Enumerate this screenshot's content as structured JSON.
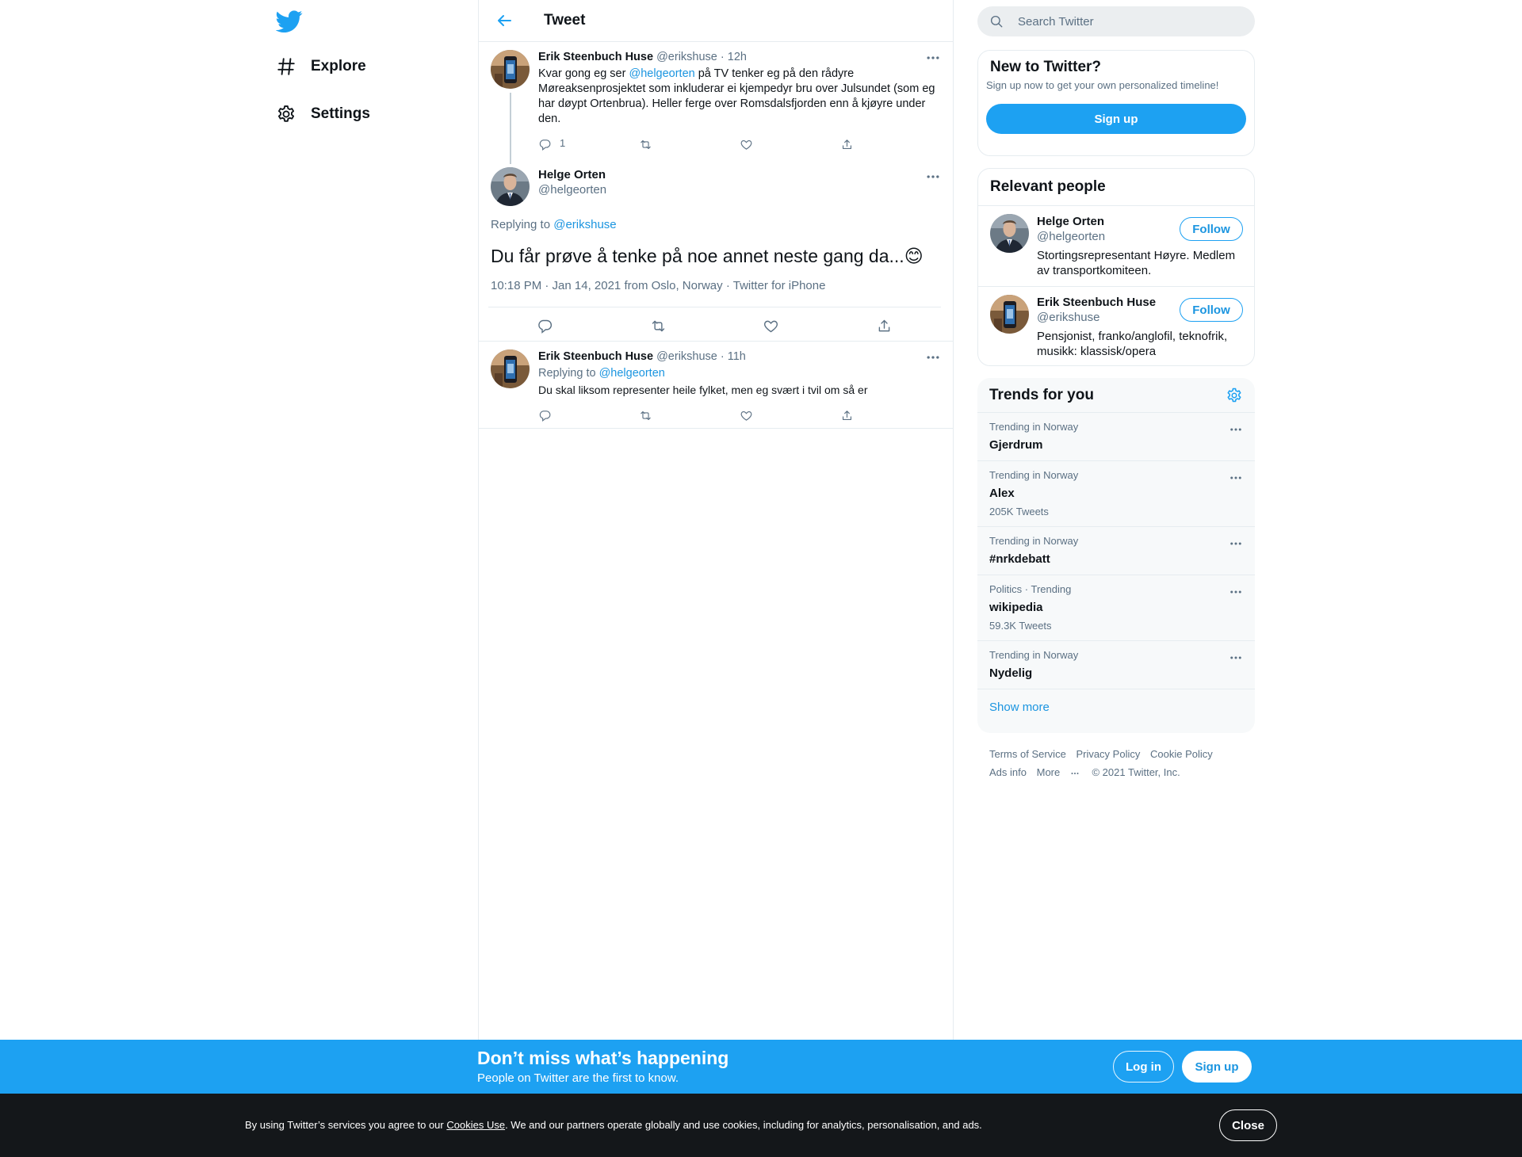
{
  "nav": {
    "explore_label": "Explore",
    "settings_label": "Settings"
  },
  "header": {
    "title": "Tweet"
  },
  "parent_tweet": {
    "name": "Erik Steenbuch Huse",
    "handle": "@erikshuse",
    "time": "12h",
    "text_before": "Kvar gong eg ser ",
    "mention": "@helgeorten",
    "text_after": " på TV tenker eg på den rådyre Møreaksenprosjektet som inkluderar ei kjempedyr bru over Julsundet (som eg har døypt Ortenbrua).  Heller ferge over Romsdalsfjorden enn å kjøyre under den.",
    "reply_count": "1"
  },
  "main_tweet": {
    "name": "Helge Orten",
    "handle": "@helgeorten",
    "replying_to_label": "Replying to ",
    "replying_to_handle": "@erikshuse",
    "text": "Du får prøve å tenke på noe annet neste gang da...",
    "emoji": "😊",
    "time": "10:18 PM · Jan 14, 2021",
    "location": "from Oslo, Norway",
    "source": "Twitter for iPhone"
  },
  "reply_tweet": {
    "name": "Erik Steenbuch Huse",
    "handle": "@erikshuse",
    "time": "11h",
    "replying_to_label": "Replying to ",
    "replying_to_handle": "@helgeorten",
    "text": "Du skal liksom representer heile fylket, men eg svært i tvil om så er"
  },
  "search": {
    "placeholder": "Search Twitter"
  },
  "signup_card": {
    "title": "New to Twitter?",
    "subtitle": "Sign up now to get your own personalized timeline!",
    "button": "Sign up"
  },
  "relevant_people": {
    "title": "Relevant people",
    "people": [
      {
        "name": "Helge Orten",
        "handle": "@helgeorten",
        "bio": "Stortingsrepresentant Høyre. Medlem av transportkomiteen.",
        "follow": "Follow"
      },
      {
        "name": "Erik Steenbuch Huse",
        "handle": "@erikshuse",
        "bio": "Pensjonist, franko/anglofil, teknofrik, musikk: klassisk/opera",
        "follow": "Follow"
      }
    ]
  },
  "trends": {
    "title": "Trends for you",
    "items": [
      {
        "context": "Trending in Norway",
        "name": "Gjerdrum",
        "count": ""
      },
      {
        "context": "Trending in Norway",
        "name": "Alex",
        "count": "205K Tweets"
      },
      {
        "context": "Trending in Norway",
        "name": "#nrkdebatt",
        "count": ""
      },
      {
        "context": "Politics · Trending",
        "name": "wikipedia",
        "count": "59.3K Tweets"
      },
      {
        "context": "Trending in Norway",
        "name": "Nydelig",
        "count": ""
      }
    ],
    "show_more": "Show more"
  },
  "footer": {
    "terms": "Terms of Service",
    "privacy": "Privacy Policy",
    "cookie": "Cookie Policy",
    "ads": "Ads info",
    "more": "More",
    "copyright": "© 2021 Twitter, Inc."
  },
  "bottom_bar": {
    "title": "Don’t miss what’s happening",
    "subtitle": "People on Twitter are the first to know.",
    "login": "Log in",
    "signup": "Sign up"
  },
  "cookie_bar": {
    "text_before": "By using Twitter’s services you agree to our ",
    "link": "Cookies Use",
    "text_after": ". We and our partners operate globally and use cookies, including for analytics, personalisation, and ads.",
    "close": "Close"
  },
  "colors": {
    "accent": "#1da1f2",
    "link": "#1b95e0",
    "muted": "#5b7083",
    "dark": "#14171a"
  }
}
